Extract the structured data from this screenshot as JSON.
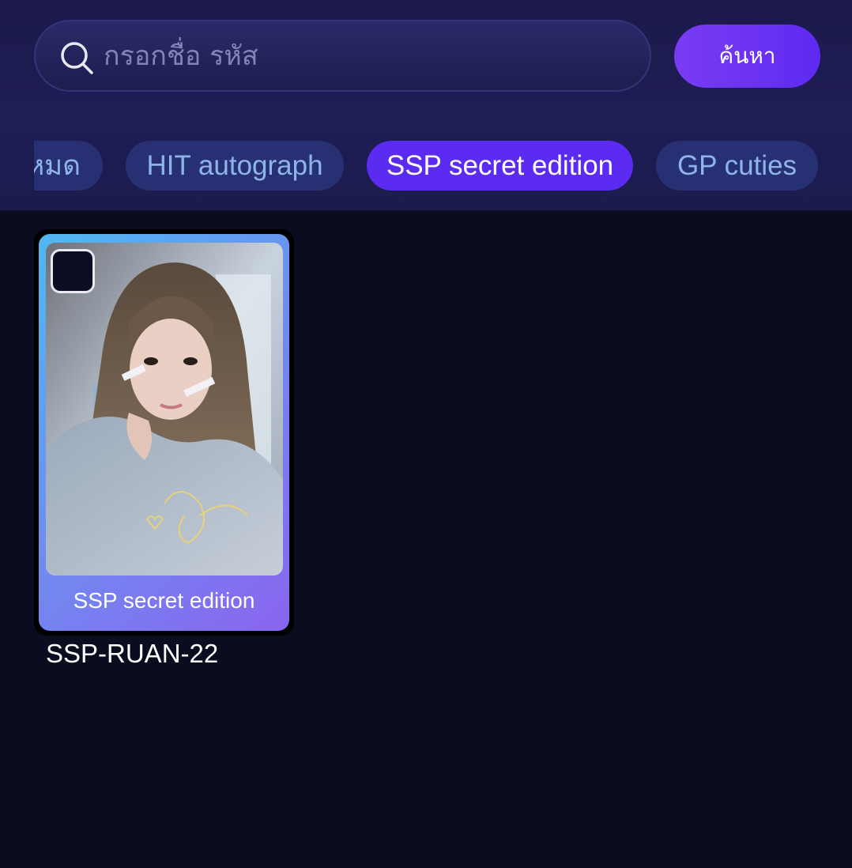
{
  "search": {
    "placeholder": "กรอกชื่อ รหัส",
    "button_label": "ค้นหา"
  },
  "tabs": [
    {
      "label": "ทั้งหมด",
      "active": false
    },
    {
      "label": "HIT autograph",
      "active": false
    },
    {
      "label": "SSP secret edition",
      "active": true
    },
    {
      "label": "GP cuties",
      "active": false
    }
  ],
  "cards": [
    {
      "edition": "SSP secret edition",
      "code": "SSP-RUAN-22",
      "selected": false
    }
  ],
  "colors": {
    "accent": "#5b2bf2",
    "tab_inactive": "#283074",
    "background": "#0a0c1f"
  }
}
